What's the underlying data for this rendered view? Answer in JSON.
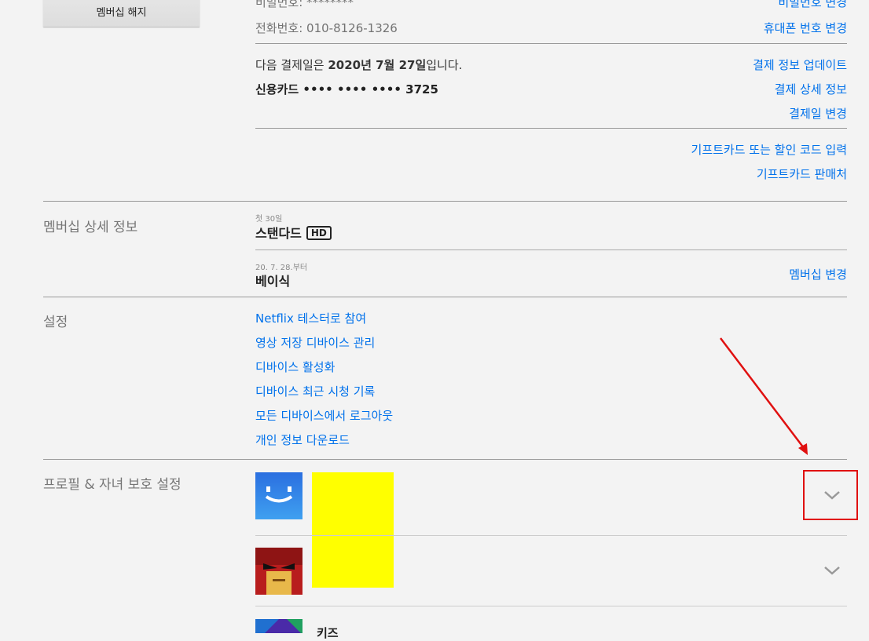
{
  "membership": {
    "cancel_button": "멤버십 해지",
    "password_label": "비밀번호: ********",
    "password_change": "비밀번호 변경",
    "phone_label": "전화번호: 010-8126-1326",
    "phone_change": "휴대폰 번호 변경",
    "next_billing_pre": "다음 결제일은 ",
    "next_billing_date": "2020년 7월 27일",
    "next_billing_post": "입니다.",
    "card_label": "신용카드 •••• •••• •••• 3725",
    "update_payment": "결제 정보 업데이트",
    "billing_details": "결제 상세 정보",
    "change_billing_day": "결제일 변경",
    "gift_code": "기프트카드 또는 할인 코드 입력",
    "gift_sellers": "기프트카드 판매처"
  },
  "plan": {
    "section_title": "멤버십 상세 정보",
    "first_note": "첫 30일",
    "current_plan": "스탠다드",
    "hd_badge": "HD",
    "from_note": "20. 7. 28.부터",
    "next_plan": "베이식",
    "change_plan": "멤버십 변경"
  },
  "settings": {
    "section_title": "설정",
    "links": [
      "Netflix 테스터로 참여",
      "영상 저장 디바이스 관리",
      "디바이스 활성화",
      "디바이스 최근 시청 기록",
      "모든 디바이스에서 로그아웃",
      "개인 정보 다운로드"
    ]
  },
  "profiles": {
    "section_title": "프로필 & 자녀 보호 설정",
    "items": [
      {
        "avatar": "smiley-blue-avatar",
        "color": "#2f80ed"
      },
      {
        "avatar": "red-character-avatar",
        "color": "#c0392b"
      },
      {
        "avatar": "purple-avatar",
        "label": "키즈"
      }
    ],
    "redaction_color": "#ffff00"
  },
  "annotation": {
    "arrow_color": "#e01010"
  }
}
